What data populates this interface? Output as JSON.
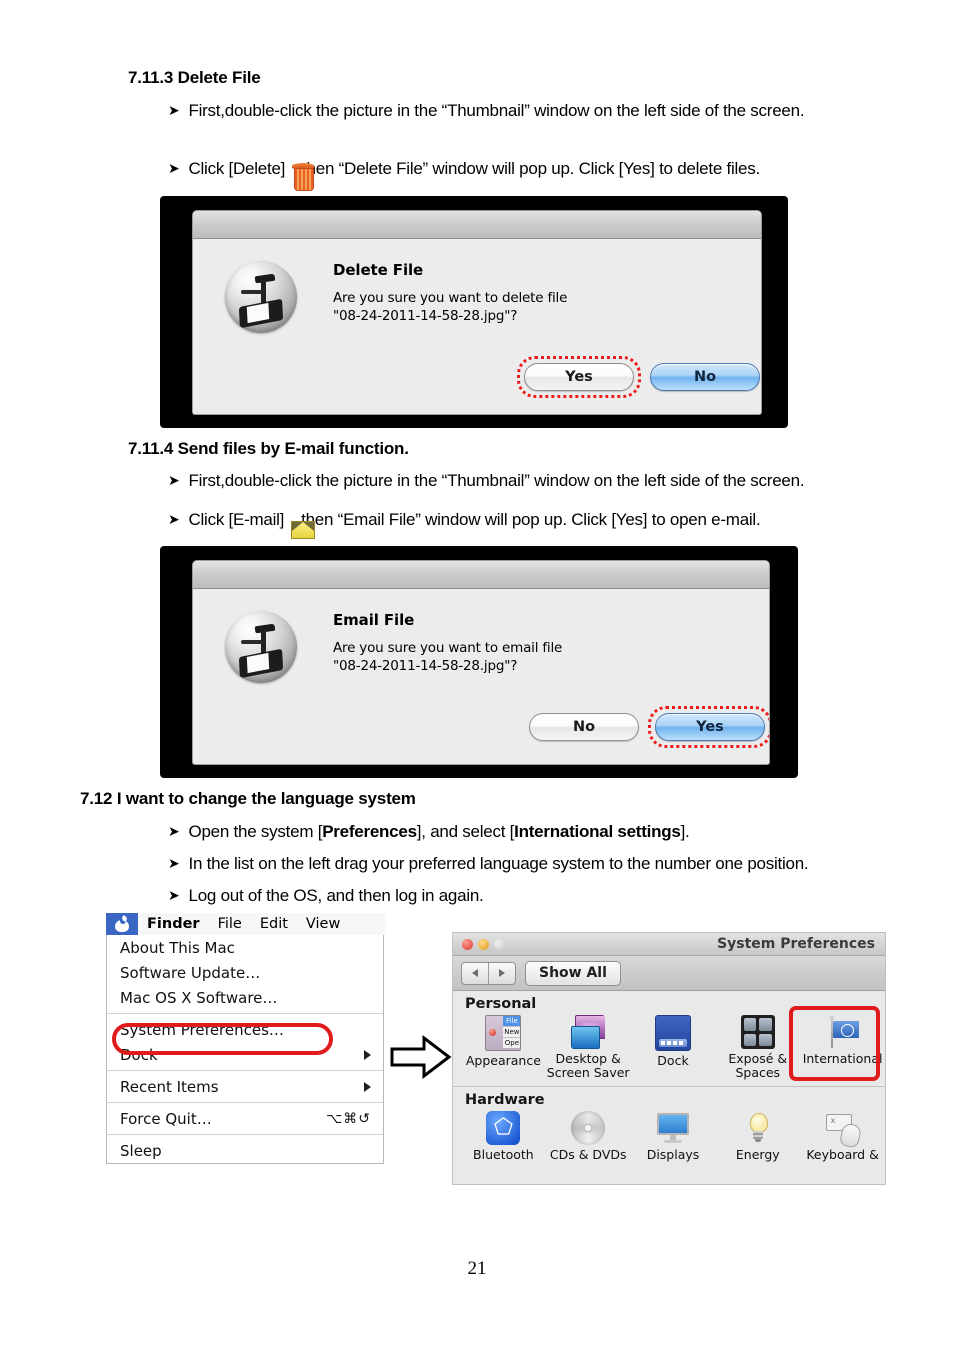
{
  "page": {
    "number": "21"
  },
  "sections": [
    {
      "id": "delete-file",
      "number": "7.11.3",
      "title": "Delete File",
      "bullets": [
        {
          "text": "First,double-click the picture in the “Thumbnail” window on the left side of the screen."
        },
        {
          "pre": "Click [Delete]",
          "icon": "trash-icon",
          "post": ", then “Delete File” window will pop up. Click [Yes] to delete files."
        }
      ]
    },
    {
      "id": "email-file",
      "number": "7.11.4",
      "title": "Send files by E-mail function.",
      "bullets": [
        {
          "text": "First,double-click the picture in the “Thumbnail” window on the left side of the screen."
        },
        {
          "pre": "Click [E-mail]",
          "icon": "envelope-icon",
          "post": ", then “Email File” window will pop up. Click [Yes] to open e-mail."
        }
      ]
    },
    {
      "id": "language-system",
      "number": "7.12",
      "title": "I want to change the language system",
      "bullets": [
        {
          "html_parts": [
            "Open the system [",
            "Preferences",
            "], and select [",
            "International settings",
            "]."
          ]
        },
        {
          "text": "In the list on the left drag your preferred language system to the number one position."
        },
        {
          "text": "Log out of the OS, and then log in again."
        }
      ]
    }
  ],
  "delete_dialog": {
    "title": "Delete File",
    "message_line1": "Are you sure you want to delete file",
    "message_line2": "\"08-24-2011-14-58-28.jpg\"?",
    "buttons": [
      {
        "label": "Yes",
        "style": "default",
        "highlighted": true
      },
      {
        "label": "No",
        "style": "primary",
        "highlighted": false
      }
    ],
    "icon": "scanner-camera-icon"
  },
  "email_dialog": {
    "title": "Email File",
    "message_line1": "Are you sure you want to email file",
    "message_line2": "\"08-24-2011-14-58-28.jpg\"?",
    "buttons": [
      {
        "label": "No",
        "style": "default",
        "highlighted": false
      },
      {
        "label": "Yes",
        "style": "primary",
        "highlighted": true
      }
    ],
    "icon": "scanner-camera-icon"
  },
  "mac_menu": {
    "menubar": [
      {
        "label": "Finder",
        "bold": true
      },
      {
        "label": "File",
        "bold": false
      },
      {
        "label": "Edit",
        "bold": false
      },
      {
        "label": "View",
        "bold": false
      }
    ],
    "items": [
      {
        "label": "About This Mac",
        "shortcut": "",
        "submenu": false,
        "sep_after": false
      },
      {
        "label": "Software Update…",
        "shortcut": "",
        "submenu": false,
        "sep_after": false
      },
      {
        "label": "Mac OS X Software…",
        "shortcut": "",
        "submenu": false,
        "sep_after": true
      },
      {
        "label": "System Preferences…",
        "shortcut": "",
        "submenu": false,
        "sep_after": false,
        "highlighted": true
      },
      {
        "label": "Dock",
        "shortcut": "",
        "submenu": true,
        "sep_after": true
      },
      {
        "label": "Recent Items",
        "shortcut": "",
        "submenu": true,
        "sep_after": true
      },
      {
        "label": "Force Quit…",
        "shortcut": "⌥⌘↺",
        "submenu": false,
        "sep_after": true
      },
      {
        "label": "Sleep",
        "shortcut": "",
        "submenu": false,
        "sep_after": false
      }
    ]
  },
  "system_preferences": {
    "window_title": "System Preferences",
    "toolbar": {
      "back_icon": "chevron-left-icon",
      "forward_icon": "chevron-right-icon",
      "show_all_label": "Show All"
    },
    "groups": [
      {
        "label": "Personal",
        "items": [
          {
            "label": "Appearance",
            "icon": "appearance-icon",
            "highlighted": false
          },
          {
            "label": "Desktop &\nScreen Saver",
            "icon": "desktop-screensaver-icon",
            "highlighted": false
          },
          {
            "label": "Dock",
            "icon": "dock-icon",
            "highlighted": false
          },
          {
            "label": "Exposé &\nSpaces",
            "icon": "expose-spaces-icon",
            "highlighted": false
          },
          {
            "label": "International",
            "icon": "international-flag-icon",
            "highlighted": true
          }
        ]
      },
      {
        "label": "Hardware",
        "items": [
          {
            "label": "Bluetooth",
            "icon": "bluetooth-icon",
            "highlighted": false
          },
          {
            "label": "CDs & DVDs",
            "icon": "cd-dvd-icon",
            "highlighted": false
          },
          {
            "label": "Displays",
            "icon": "display-icon",
            "highlighted": false
          },
          {
            "label": "Energy",
            "icon": "lightbulb-icon",
            "highlighted": false
          },
          {
            "label": "Keyboard &",
            "icon": "keyboard-mouse-icon",
            "highlighted": false
          }
        ]
      }
    ]
  },
  "colors": {
    "highlight_red": "#e01b1b",
    "dotted_red": "#ee1c1c",
    "aqua_blue": "#6fb3ef"
  }
}
